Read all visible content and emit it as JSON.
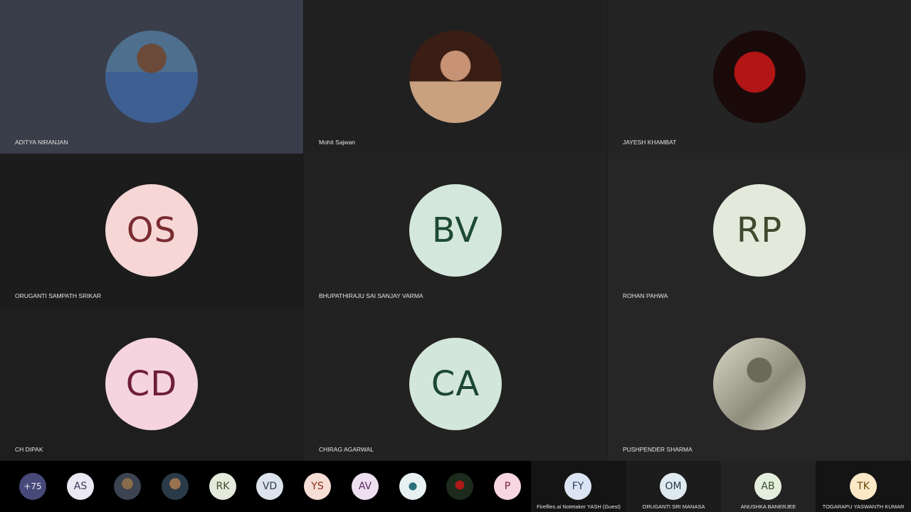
{
  "tiles": [
    {
      "name": "ADITYA NIRANJAN",
      "type": "photo",
      "icon": "person-photo"
    },
    {
      "name": "Mohit Sajwan",
      "type": "photo",
      "icon": "person-photo"
    },
    {
      "name": "JAYESH KHAMBAT",
      "type": "photo",
      "icon": "red-hooded-figure-photo"
    },
    {
      "name": "ORUGANTI SAMPATH SRIKAR",
      "initials": "OS",
      "bg": "#f6d7d6",
      "fg": "#7a2c31"
    },
    {
      "name": "BHUPATHIRAJU SAI SANJAY VARMA",
      "initials": "BV",
      "bg": "#d4e7dc",
      "fg": "#1d4a31"
    },
    {
      "name": "ROHAN PAHWA",
      "initials": "RP",
      "bg": "#e4eadb",
      "fg": "#3e4a2c"
    },
    {
      "name": "CH DIPAK",
      "initials": "CD",
      "bg": "#f5d3df",
      "fg": "#6e1e38"
    },
    {
      "name": "CHIRAG AGARWAL",
      "initials": "CA",
      "bg": "#d3e6dc",
      "fg": "#1c4833"
    },
    {
      "name": "PUSHPENDER SHARMA",
      "type": "photo",
      "icon": "person-photo"
    }
  ],
  "strip": {
    "overflow_count": "+75",
    "chips": [
      {
        "initials": "AS",
        "bg": "#e9e8f3",
        "fg": "#393a55"
      },
      {
        "type": "photo",
        "icon": "person-photo"
      },
      {
        "type": "photo",
        "icon": "person-photo"
      },
      {
        "initials": "RK",
        "bg": "#e4eadb",
        "fg": "#3e4a2c"
      },
      {
        "initials": "VD",
        "bg": "#dce3ec",
        "fg": "#2d3d4e"
      },
      {
        "initials": "YS",
        "bg": "#f6ddd5",
        "fg": "#8a2d1e"
      },
      {
        "initials": "AV",
        "bg": "#eedff0",
        "fg": "#5a2a60"
      },
      {
        "type": "photo",
        "icon": "creature-photo"
      },
      {
        "type": "photo",
        "icon": "sports-photo"
      },
      {
        "initials": "P",
        "bg": "#f7d6e2",
        "fg": "#6e1e38"
      }
    ],
    "mini_tiles": [
      {
        "name": "Fireflies.ai Notetaker YASH (Guest)",
        "initials": "FY",
        "bg": "#dbe4f3",
        "fg": "#2b3b58"
      },
      {
        "name": "ORUGANTI SRI MANASA",
        "initials": "OM",
        "bg": "#dfeaf0",
        "fg": "#243a48"
      },
      {
        "name": "ANUSHKA BANERJEE",
        "initials": "AB",
        "bg": "#e4eedd",
        "fg": "#344a2c"
      },
      {
        "name": "TOGARAPU YASWANTH KUMAR",
        "initials": "TK",
        "bg": "#fbe8c6",
        "fg": "#6a4a10"
      }
    ]
  }
}
